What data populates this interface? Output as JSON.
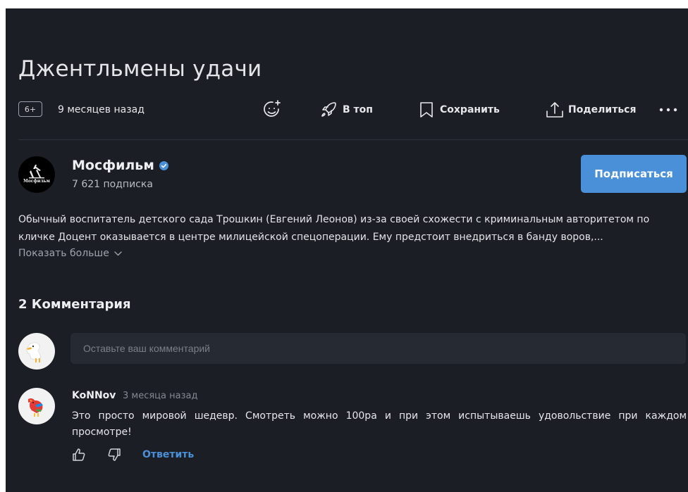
{
  "video": {
    "title": "Джентльмены удачи",
    "age_rating": "6+",
    "published": "9 месяцев назад"
  },
  "actions": {
    "react_icon": "emoji-add-icon",
    "top_label": "В топ",
    "save_label": "Сохранить",
    "share_label": "Поделиться",
    "more_icon": "more-horizontal-icon"
  },
  "channel": {
    "name": "Мосфильм",
    "logo_text": "Мосфильм",
    "verified": true,
    "subscribers": "7 621 подписка",
    "subscribe_label": "Подписаться"
  },
  "description": {
    "line1": "Обычный воспитатель детского сада Трошкин (Евгений Леонов) из-за своей схожести с криминальным авторитетом по",
    "line2": "кличке Доцент оказывается в центре милицейской спецоперации. Ему предстоит внедриться в банду воров,...",
    "show_more": "Показать больше"
  },
  "comments": {
    "heading": "2 Комментария",
    "input_placeholder": "Оставьте ваш комментарий",
    "items": [
      {
        "author": "KoNNov",
        "time": "3 месяца назад",
        "text": "Это просто мировой шедевр. Смотреть можно 100ра и при этом испытываешь удовольствие при каждом просмотре!",
        "reply_label": "Ответить"
      }
    ]
  },
  "colors": {
    "background": "#1c1e26",
    "accent": "#4a90d9",
    "input_bg": "#262a33"
  }
}
